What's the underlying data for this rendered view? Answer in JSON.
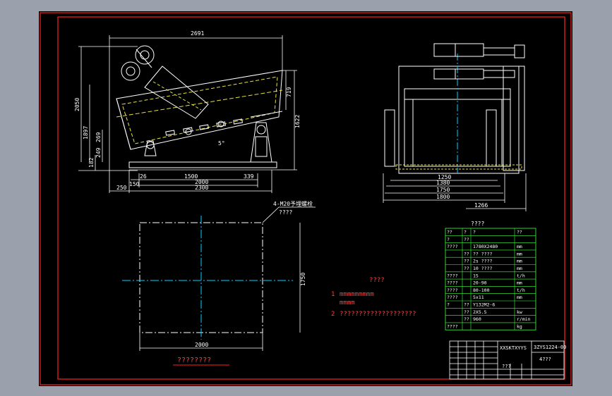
{
  "colors": {
    "background": "#000000",
    "frame": "#ff2020",
    "dimension": "#ffffff",
    "structure": "#ffffff",
    "centerline": "#00d0ff",
    "screen": "#e8e040",
    "table": "#40ff40",
    "note": "#00ffff",
    "annotation": "#ff4040"
  },
  "side_view": {
    "overall_length": "2691",
    "height_total": "2050",
    "height_1": "1897",
    "dim_269": "269",
    "dim_249": "249",
    "dim_182": "182",
    "right_719": "719",
    "right_1622": "1622",
    "dim_26": "26",
    "dim_1500": "1500",
    "dim_339": "339",
    "dim_150": "150",
    "dim_2000": "2000",
    "dim_2300": "2300",
    "dim_250": "250",
    "angle": "5°"
  },
  "end_view": {
    "w_1250": "1250",
    "w_1380": "1380",
    "w_1750": "1750",
    "w_1800": "1800",
    "w_1266": "1266"
  },
  "foundation_plan": {
    "bolt_label": "4-M20",
    "bolt_label_cn": "予埋螺栓",
    "bolt_sub": "????",
    "width": "2000",
    "height": "1750",
    "caption": "????????"
  },
  "notes": {
    "title": "????",
    "item1_num": "1",
    "item1_line1": "mmmmmmmmm",
    "item1_line2": "mmmm",
    "item2_num": "2",
    "item2_text": "????????????????????"
  },
  "spec_table": {
    "title": "????",
    "rows": [
      {
        "c1": "??",
        "c2": "?",
        "c3": "?",
        "unit": "??"
      },
      {
        "c1": "?",
        "c2": "??",
        "c3": "",
        "unit": ""
      },
      {
        "c1": "????",
        "c2": "",
        "c3": "1780X2480",
        "unit": "mm"
      },
      {
        "c1": "",
        "c2": "??",
        "c3": "?? ????",
        "unit": "mm"
      },
      {
        "c1": "",
        "c2": "??",
        "c3": "2s ????",
        "unit": "mm"
      },
      {
        "c1": "",
        "c2": "??",
        "c3": "10 ????",
        "unit": "mm"
      },
      {
        "c1": "????",
        "c2": "",
        "c3": "15",
        "unit": "t/h"
      },
      {
        "c1": "????",
        "c2": "",
        "c3": "20-90",
        "unit": "mm"
      },
      {
        "c1": "????",
        "c2": "",
        "c3": "80-100",
        "unit": "t/h"
      },
      {
        "c1": "????",
        "c2": "",
        "c3": "5x11",
        "unit": "mm"
      },
      {
        "c1": "?",
        "c2": "??",
        "c3": "Y132M2-6",
        "unit": ""
      },
      {
        "c1": "",
        "c2": "??",
        "c3": "2X5.5",
        "unit": "kw"
      },
      {
        "c1": "",
        "c2": "??",
        "c3": "960",
        "unit": "r/min"
      },
      {
        "c1": "????",
        "c2": "",
        "c3": "",
        "unit": "kg"
      }
    ]
  },
  "title_block": {
    "drawing_no": "3ZYS1224-00",
    "name": "XXSKTXYYS",
    "scale": "???",
    "sub": "4???"
  }
}
